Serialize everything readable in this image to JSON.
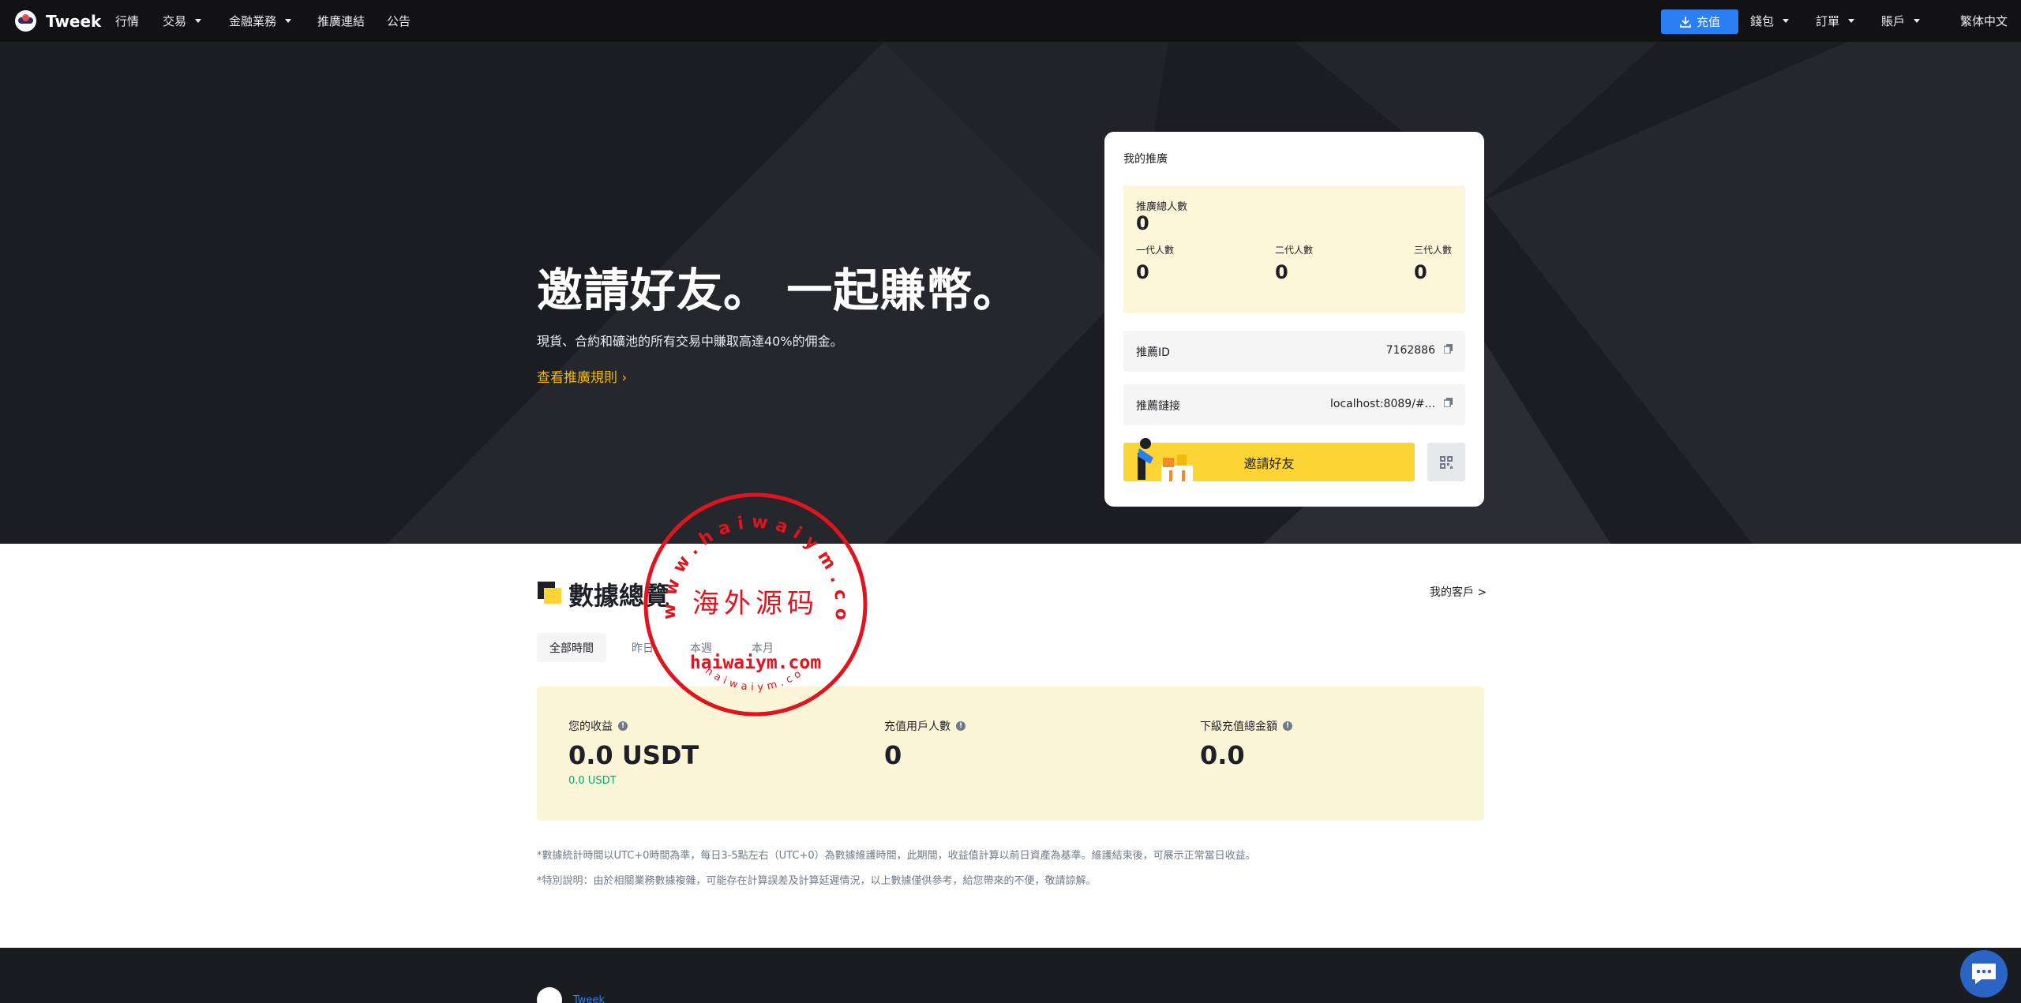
{
  "nav": {
    "brand": "Tweek",
    "items": [
      {
        "label": "行情",
        "caret": false
      },
      {
        "label": "交易",
        "caret": true
      },
      {
        "label": "金融業務",
        "caret": true
      },
      {
        "label": "推廣連結",
        "caret": false
      },
      {
        "label": "公告",
        "caret": false
      }
    ],
    "deposit_label": "充值",
    "right_items": [
      {
        "label": "錢包",
        "caret": true
      },
      {
        "label": "訂單",
        "caret": true
      },
      {
        "label": "賬戶",
        "caret": true
      }
    ],
    "language": "繁体中文"
  },
  "hero": {
    "title": "邀請好友。 一起賺幣。",
    "subtitle": "現貨、合約和礦池的所有交易中賺取高達40%的佣金。",
    "rules_link": "查看推廣規則 ›"
  },
  "promo_card": {
    "title": "我的推廣",
    "total_label": "推廣總人數",
    "total_value": "0",
    "tiers": [
      {
        "label": "一代人數",
        "value": "0"
      },
      {
        "label": "二代人數",
        "value": "0"
      },
      {
        "label": "三代人數",
        "value": "0"
      }
    ],
    "referral_id_label": "推薦ID",
    "referral_id_value": "7162886",
    "referral_link_label": "推薦鏈接",
    "referral_link_value": "localhost:8089/#...",
    "invite_button": "邀請好友"
  },
  "overview": {
    "title": "數據總覽",
    "my_clients_link": "我的客戶 >",
    "tabs": [
      "全部時間",
      "昨日",
      "本週",
      "本月"
    ],
    "active_tab": 0,
    "stats": [
      {
        "label": "您的收益",
        "value": "0.0 USDT",
        "sub": "0.0 USDT"
      },
      {
        "label": "充值用戶人數",
        "value": "0",
        "sub": ""
      },
      {
        "label": "下級充值總金額",
        "value": "0.0",
        "sub": ""
      }
    ],
    "notes": [
      "*數據統計時間以UTC+0時間為準，每日3-5點左右（UTC+0）為數據維護時間，此期間，收益值計算以前日資產為基準。維護結束後，可展示正常當日收益。",
      "*特別說明：由於相關業務數據複雜，可能存在計算誤差及計算延遲情況，以上數據僅供參考，給您帶來的不便，敬請諒解。"
    ]
  },
  "footer": {
    "brand": "Tweek"
  },
  "watermark": {
    "top_arc": "www.haiwaiym.com",
    "center": "海外源码",
    "domain": "haiwaiym.com",
    "bottom_arc": "haiwaiym.com"
  },
  "colors": {
    "accent_yellow": "#fcd535",
    "link_gold": "#f0b90b",
    "deposit_blue": "#2a7ff5",
    "stamp_red": "#e0141e",
    "positive_green": "#03a66d"
  }
}
